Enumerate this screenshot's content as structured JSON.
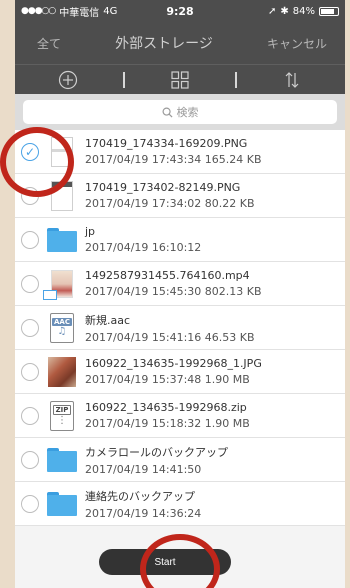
{
  "status": {
    "carrier": "中華電信",
    "network": "4G",
    "time": "9:28",
    "battery": "84%",
    "battery_fill": 0.84
  },
  "nav": {
    "left": "全て",
    "title": "外部ストレージ",
    "right": "キャンセル"
  },
  "toolbar": {
    "icons": [
      "add-icon",
      "grid-icon",
      "sort-icon"
    ]
  },
  "search": {
    "placeholder": "検索"
  },
  "files": [
    {
      "name": "170419_174334-169209.PNG",
      "info": "2017/04/19 17:43:34  165.24 KB",
      "kind": "screenshot",
      "checked": true
    },
    {
      "name": "170419_173402-82149.PNG",
      "info": "2017/04/19 17:34:02  80.22 KB",
      "kind": "screenshot-dark",
      "checked": false
    },
    {
      "name": "jp",
      "info": "2017/04/19 16:10:12",
      "kind": "folder",
      "checked": false
    },
    {
      "name": "1492587931455.764160.mp4",
      "info": "2017/04/19 15:45:30  802.13 KB",
      "kind": "video",
      "checked": false
    },
    {
      "name": "新規.aac",
      "info": "2017/04/19 15:41:16  46.53 KB",
      "kind": "audio",
      "checked": false
    },
    {
      "name": "160922_134635-1992968_1.JPG",
      "info": "2017/04/19 15:37:48  1.90 MB",
      "kind": "photo",
      "checked": false
    },
    {
      "name": "160922_134635-1992968.zip",
      "info": "2017/04/19 15:18:32  1.90 MB",
      "kind": "zip",
      "checked": false
    },
    {
      "name": "カメラロールのバックアップ",
      "info": "2017/04/19 14:41:50",
      "kind": "folder",
      "checked": false
    },
    {
      "name": "連絡先のバックアップ",
      "info": "2017/04/19 14:36:24",
      "kind": "folder",
      "checked": false
    }
  ],
  "labels": {
    "aac": "AAC",
    "zip": "ZIP"
  },
  "start": {
    "label": "Start"
  },
  "colors": {
    "accent": "#4aa3e6",
    "highlight_ring": "#c0261b",
    "bar": "#4d4d4d"
  }
}
